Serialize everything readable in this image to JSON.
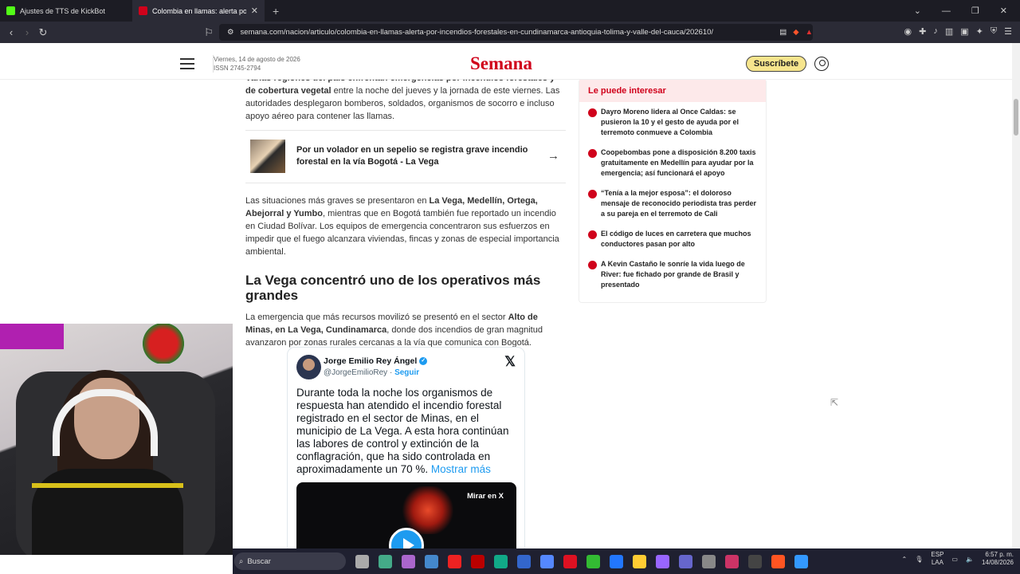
{
  "browser": {
    "tabs": [
      {
        "title": "Ajustes de TTS de KickBot",
        "active": false,
        "favicon_color": "#53fc18"
      },
      {
        "title": "Colombia en llamas: alerta por in",
        "active": true,
        "favicon_color": "#d0021b"
      }
    ],
    "url": "semana.com/nacion/articulo/colombia-en-llamas-alerta-por-incendios-forestales-en-cundinamarca-antioquia-tolima-y-valle-del-cauca/202610/"
  },
  "header": {
    "date": "Viernes, 14 de agosto de 2026",
    "issn": "ISSN 2745-2794",
    "logo": "Semana",
    "subscribe": "Suscríbete"
  },
  "article": {
    "p1_lead": "Varias regiones del país enfrentan emergencias por incendios forestales y de",
    "p1_bold": "cobertura vegetal",
    "p1_rest": " entre la noche del jueves y la jornada de este viernes. Las autoridades desplegaron bomberos, soldados, organismos de socorro e incluso apoyo aéreo para contener las llamas.",
    "related": "Por un volador en un sepelio se registra grave incendio forestal en la vía Bogotá - La Vega",
    "p2_a": "Las situaciones más graves se presentaron en ",
    "p2_bold": "La Vega, Medellín, Ortega, Abejorral y Yumbo",
    "p2_b": ", mientras que en Bogotá también fue reportado un incendio en Ciudad Bolívar. Los equipos de emergencia concentraron sus esfuerzos en impedir que el fuego alcanzara viviendas, fincas y zonas de especial importancia ambiental.",
    "heading": "La Vega concentró uno de los operativos más grandes",
    "p3_a": "La emergencia que más recursos movilizó se presentó en el sector ",
    "p3_bold": "Alto de Minas, en La Vega, Cundinamarca",
    "p3_b": ", donde dos incendios de gran magnitud avanzaron por zonas rurales cercanas a la vía que comunica con Bogotá."
  },
  "tweet": {
    "name": "Jorge Emilio Rey Ángel",
    "handle": "@JorgeEmilioRey",
    "follow": "Seguir",
    "text": "Durante toda la noche los organismos de respuesta han atendido el incendio forestal registrado en el sector de Minas, en el municipio de La Vega. A esta hora continúan las labores de control y extinción de la conflagración, que ha sido controlada en aproximadamente un 70 %.",
    "more": "Mostrar más",
    "mirar": "Mirar en X"
  },
  "sidebar": {
    "title": "Le puede interesar",
    "items": [
      "Dayro Moreno lidera al Once Caldas: se pusieron la 10 y el gesto de ayuda por el terremoto conmueve a Colombia",
      "Coopebombas pone a disposición 8.200 taxis gratuitamente en Medellín para ayudar por la emergencia; así funcionará el apoyo",
      "“Tenía a la mejor esposa”: el doloroso mensaje de reconocido periodista tras perder a su pareja en el terremoto de Cali",
      "El código de luces en carretera que muchos conductores pasan por alto",
      "A Kevin Castaño le sonríe la vida luego de River: fue fichado por grande de Brasil y presentado"
    ]
  },
  "taskbar": {
    "search": "Buscar",
    "lang1": "ESP",
    "lang2": "LAA",
    "time": "6:57 p. m.",
    "date": "14/08/2026"
  }
}
